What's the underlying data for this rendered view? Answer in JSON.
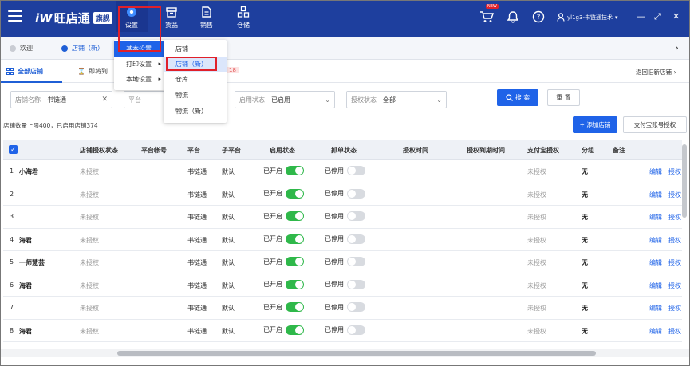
{
  "header": {
    "logo_mark": "iW",
    "logo_text": "旺店通",
    "logo_badge": "旗舰",
    "nav": [
      {
        "label": "设置"
      },
      {
        "label": "货品"
      },
      {
        "label": "销售"
      },
      {
        "label": "仓储"
      }
    ],
    "cart_badge": "NEW",
    "user": "yl1g3-书链通技术"
  },
  "tabs": {
    "welcome": "欢迎",
    "store_new": "店铺（新）"
  },
  "subheader": {
    "all_stores": "全部店铺",
    "expire_label": "即将到",
    "expire_count": "18",
    "old_list": "返回旧新店铺"
  },
  "filters": {
    "name_label": "店铺名称",
    "name_value": "书链通",
    "platform_label": "平台",
    "status_label": "启用状态",
    "status_value": "已启用",
    "auth_label": "授权状态",
    "auth_value": "全部",
    "search": "搜 索",
    "reset": "重 置"
  },
  "limit_text": "店铺数量上限400，已启用店铺374",
  "actions": {
    "add": "+ 添加店铺",
    "alipay_bind": "支付宝账号授权"
  },
  "menus": {
    "level1": [
      {
        "label": "基本设置",
        "active": true
      },
      {
        "label": "打印设置",
        "active": false
      },
      {
        "label": "本地设置",
        "active": false
      }
    ],
    "level2": [
      {
        "label": "店铺",
        "active": false
      },
      {
        "label": "店铺（新）",
        "active": true
      },
      {
        "label": "仓库",
        "active": false
      },
      {
        "label": "物流",
        "active": false
      },
      {
        "label": "物流（新）",
        "active": false
      }
    ]
  },
  "table": {
    "columns": [
      "店铺授权状态",
      "平台帐号",
      "平台",
      "子平台",
      "启用状态",
      "抓单状态",
      "授权时间",
      "授权到期时间",
      "支付宝授权",
      "分组",
      "备注"
    ],
    "rows": [
      {
        "idx": "1",
        "name": "小海君",
        "auth": "未授权",
        "platform": "书链通",
        "sub": "默认",
        "enabled_text": "已开启",
        "enabled": true,
        "grab_text": "已停用",
        "grab": false,
        "alipay": "未授权",
        "group": "无"
      },
      {
        "idx": "2",
        "name": "",
        "auth": "未授权",
        "platform": "书链通",
        "sub": "默认",
        "enabled_text": "已开启",
        "enabled": true,
        "grab_text": "已停用",
        "grab": false,
        "alipay": "未授权",
        "group": "无"
      },
      {
        "idx": "3",
        "name": "",
        "auth": "未授权",
        "platform": "书链通",
        "sub": "默认",
        "enabled_text": "已开启",
        "enabled": true,
        "grab_text": "已停用",
        "grab": false,
        "alipay": "未授权",
        "group": "无"
      },
      {
        "idx": "4",
        "name": "海君",
        "auth": "未授权",
        "platform": "书链通",
        "sub": "默认",
        "enabled_text": "已开启",
        "enabled": true,
        "grab_text": "已停用",
        "grab": false,
        "alipay": "未授权",
        "group": "无"
      },
      {
        "idx": "5",
        "name": "一师慧芸",
        "auth": "未授权",
        "platform": "书链通",
        "sub": "默认",
        "enabled_text": "已开启",
        "enabled": true,
        "grab_text": "已停用",
        "grab": false,
        "alipay": "未授权",
        "group": "无"
      },
      {
        "idx": "6",
        "name": "海君",
        "auth": "未授权",
        "platform": "书链通",
        "sub": "默认",
        "enabled_text": "已开启",
        "enabled": true,
        "grab_text": "已停用",
        "grab": false,
        "alipay": "未授权",
        "group": "无"
      },
      {
        "idx": "7",
        "name": "",
        "auth": "未授权",
        "platform": "书链通",
        "sub": "默认",
        "enabled_text": "已开启",
        "enabled": true,
        "grab_text": "已停用",
        "grab": false,
        "alipay": "未授权",
        "group": "无"
      },
      {
        "idx": "8",
        "name": "海君",
        "auth": "未授权",
        "platform": "书链通",
        "sub": "默认",
        "enabled_text": "已开启",
        "enabled": true,
        "grab_text": "已停用",
        "grab": false,
        "alipay": "未授权",
        "group": "无"
      }
    ],
    "edit_label": "编辑",
    "authorize_label": "授权"
  }
}
